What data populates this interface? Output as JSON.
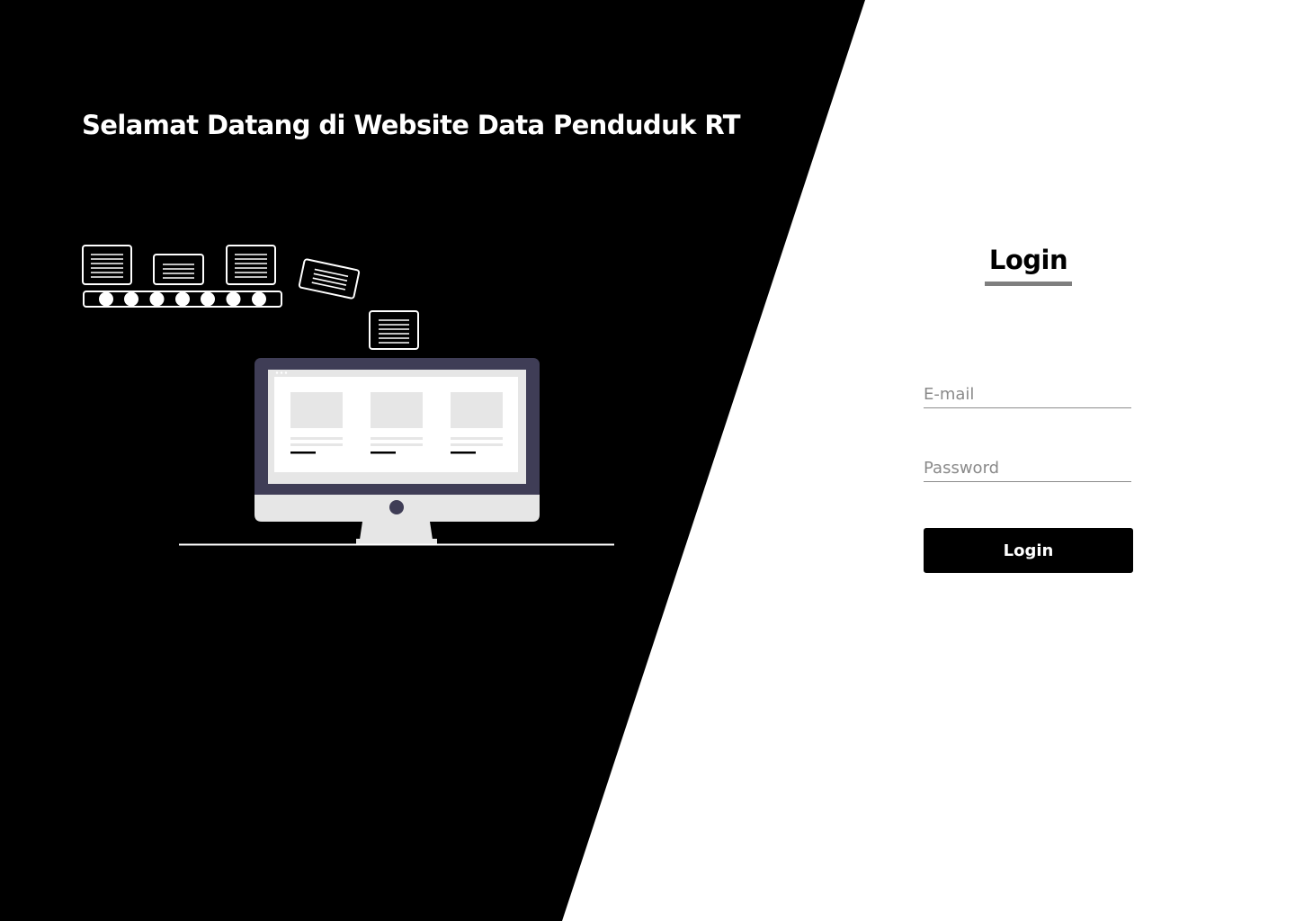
{
  "hero": {
    "title": "Selamat Datang di Website Data Penduduk RT",
    "illustration_icon": "data-processing-computer-icon"
  },
  "login_form": {
    "heading": "Login",
    "email_placeholder": "E-mail",
    "password_placeholder": "Password",
    "submit_label": "Login"
  },
  "colors": {
    "dark_panel": "#000000",
    "background": "#ffffff",
    "accent_underline": "#7f7f7f",
    "button": "#000000",
    "monitor_frame": "#3f3d56",
    "screen_cards": "#e6e6e6"
  }
}
